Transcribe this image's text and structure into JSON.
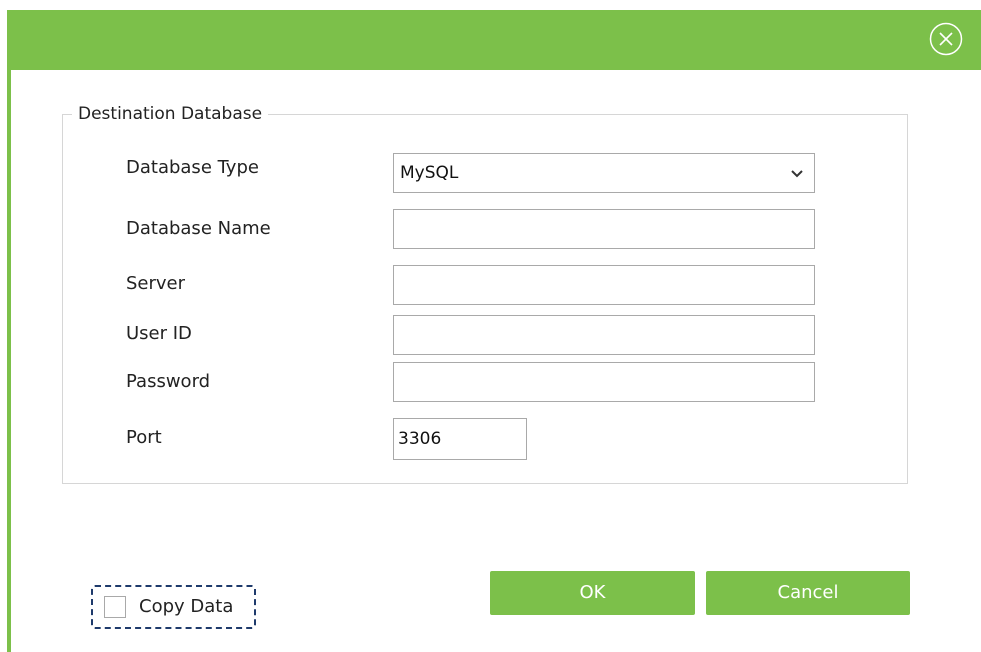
{
  "window": {
    "close_icon": "close-circle-icon",
    "accent_color": "#7cc04a"
  },
  "destination": {
    "group_title": "Destination Database",
    "fields": {
      "database_type": {
        "label": "Database Type",
        "value": "MySQL"
      },
      "database_name": {
        "label": "Database Name",
        "value": ""
      },
      "server": {
        "label": "Server",
        "value": ""
      },
      "user_id": {
        "label": "User ID",
        "value": ""
      },
      "password": {
        "label": "Password",
        "value": ""
      },
      "port": {
        "label": "Port",
        "value": "3306"
      }
    }
  },
  "options": {
    "copy_data_label": "Copy Data",
    "copy_data_checked": false
  },
  "buttons": {
    "ok_label": "OK",
    "cancel_label": "Cancel"
  }
}
